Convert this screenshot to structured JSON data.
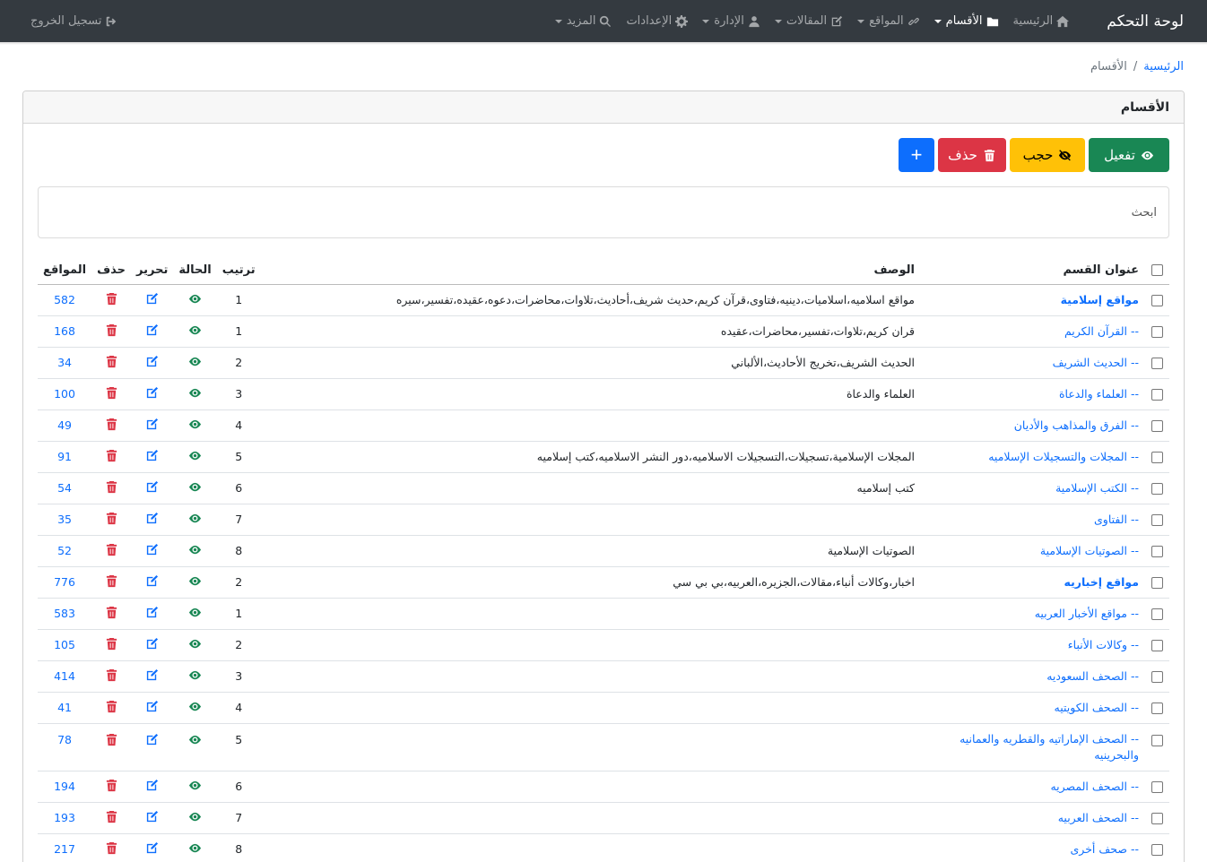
{
  "navbar": {
    "brand": "لوحة التحكم",
    "items": [
      {
        "label": "الرئيسية",
        "icon": "home-icon",
        "dropdown": false,
        "active": false
      },
      {
        "label": "الأقسام",
        "icon": "folder-icon",
        "dropdown": true,
        "active": true
      },
      {
        "label": "المواقع",
        "icon": "link-icon",
        "dropdown": true,
        "active": false
      },
      {
        "label": "المقالات",
        "icon": "edit-icon",
        "dropdown": true,
        "active": false
      },
      {
        "label": "الإدارة",
        "icon": "user-icon",
        "dropdown": true,
        "active": false
      },
      {
        "label": "الإعدادات",
        "icon": "gear-icon",
        "dropdown": false,
        "active": false
      },
      {
        "label": "المزيد",
        "icon": "search-icon",
        "dropdown": true,
        "active": false
      }
    ],
    "logout": "تسجيل الخروج"
  },
  "breadcrumb": {
    "home": "الرئيسية",
    "sep": "/",
    "current": "الأقسام"
  },
  "card": {
    "title": "الأقسام"
  },
  "toolbar": {
    "activate": "تفعيل",
    "hide": "حجب",
    "delete": "حذف",
    "add": "+"
  },
  "search": {
    "placeholder": "ابحث",
    "value": ""
  },
  "table": {
    "headers": {
      "title": "عنوان القسم",
      "desc": "الوصف",
      "order": "ترتيب",
      "status": "الحالة",
      "edit": "تحرير",
      "delete": "حذف",
      "sites": "المواقع"
    },
    "rows": [
      {
        "title": "مواقع إسلامية",
        "main": true,
        "desc": "مواقع اسلاميه،اسلاميات،دينيه،فتاوى،قرآن كريم،حديث شريف،أحاديث،تلاوات،محاضرات،دعوه،عقيده،تفسير،سيره",
        "order": "1",
        "sites": "582"
      },
      {
        "title": "-- القرآن الكريم",
        "main": false,
        "desc": "قران كريم،تلاوات،تفسير،محاضرات،عقيده",
        "order": "1",
        "sites": "168"
      },
      {
        "title": "-- الحديث الشريف",
        "main": false,
        "desc": "الحديث الشريف،تخريج الأحاديث،الألباني",
        "order": "2",
        "sites": "34"
      },
      {
        "title": "-- العلماء والدعاة",
        "main": false,
        "desc": "العلماء والدعاة",
        "order": "3",
        "sites": "100"
      },
      {
        "title": "-- الفرق والمذاهب والأديان",
        "main": false,
        "desc": "",
        "order": "4",
        "sites": "49"
      },
      {
        "title": "-- المجلات والتسجيلات الإسلاميه",
        "main": false,
        "desc": "المجلات الإسلامية،تسجيلات،التسجيلات الاسلاميه،دور النشر الاسلاميه،كتب إسلاميه",
        "order": "5",
        "sites": "91"
      },
      {
        "title": "-- الكتب الإسلامية",
        "main": false,
        "desc": "كتب إسلاميه",
        "order": "6",
        "sites": "54"
      },
      {
        "title": "-- الفتاوى",
        "main": false,
        "desc": "",
        "order": "7",
        "sites": "35"
      },
      {
        "title": "-- الصوتيات الإسلامية",
        "main": false,
        "desc": "الصوتيات الإسلامية",
        "order": "8",
        "sites": "52"
      },
      {
        "title": "مواقع إخباريه",
        "main": true,
        "desc": "اخبار،وكالات أنباء،مقالات،الجزيره،العربيه،بي بي سي",
        "order": "2",
        "sites": "776"
      },
      {
        "title": "-- مواقع الأخبار العربيه",
        "main": false,
        "desc": "",
        "order": "1",
        "sites": "583"
      },
      {
        "title": "-- وكالات الأنباء",
        "main": false,
        "desc": "",
        "order": "2",
        "sites": "105"
      },
      {
        "title": "-- الصحف السعوديه",
        "main": false,
        "desc": "",
        "order": "3",
        "sites": "414"
      },
      {
        "title": "-- الصحف الكويتيه",
        "main": false,
        "desc": "",
        "order": "4",
        "sites": "41"
      },
      {
        "title": "-- الصحف الإماراتيه والقطريه والعمانيه والبحرينيه",
        "main": false,
        "desc": "",
        "order": "5",
        "sites": "78",
        "wrap": true
      },
      {
        "title": "-- الصحف المصريه",
        "main": false,
        "desc": "",
        "order": "6",
        "sites": "194"
      },
      {
        "title": "-- الصحف العربيه",
        "main": false,
        "desc": "",
        "order": "7",
        "sites": "193"
      },
      {
        "title": "-- صحف أخرى",
        "main": false,
        "desc": "",
        "order": "8",
        "sites": "217"
      }
    ]
  },
  "colors": {
    "navbar": "#343a40",
    "link": "#0d6efd",
    "success": "#198754",
    "warning": "#ffc107",
    "danger": "#dc3545"
  }
}
